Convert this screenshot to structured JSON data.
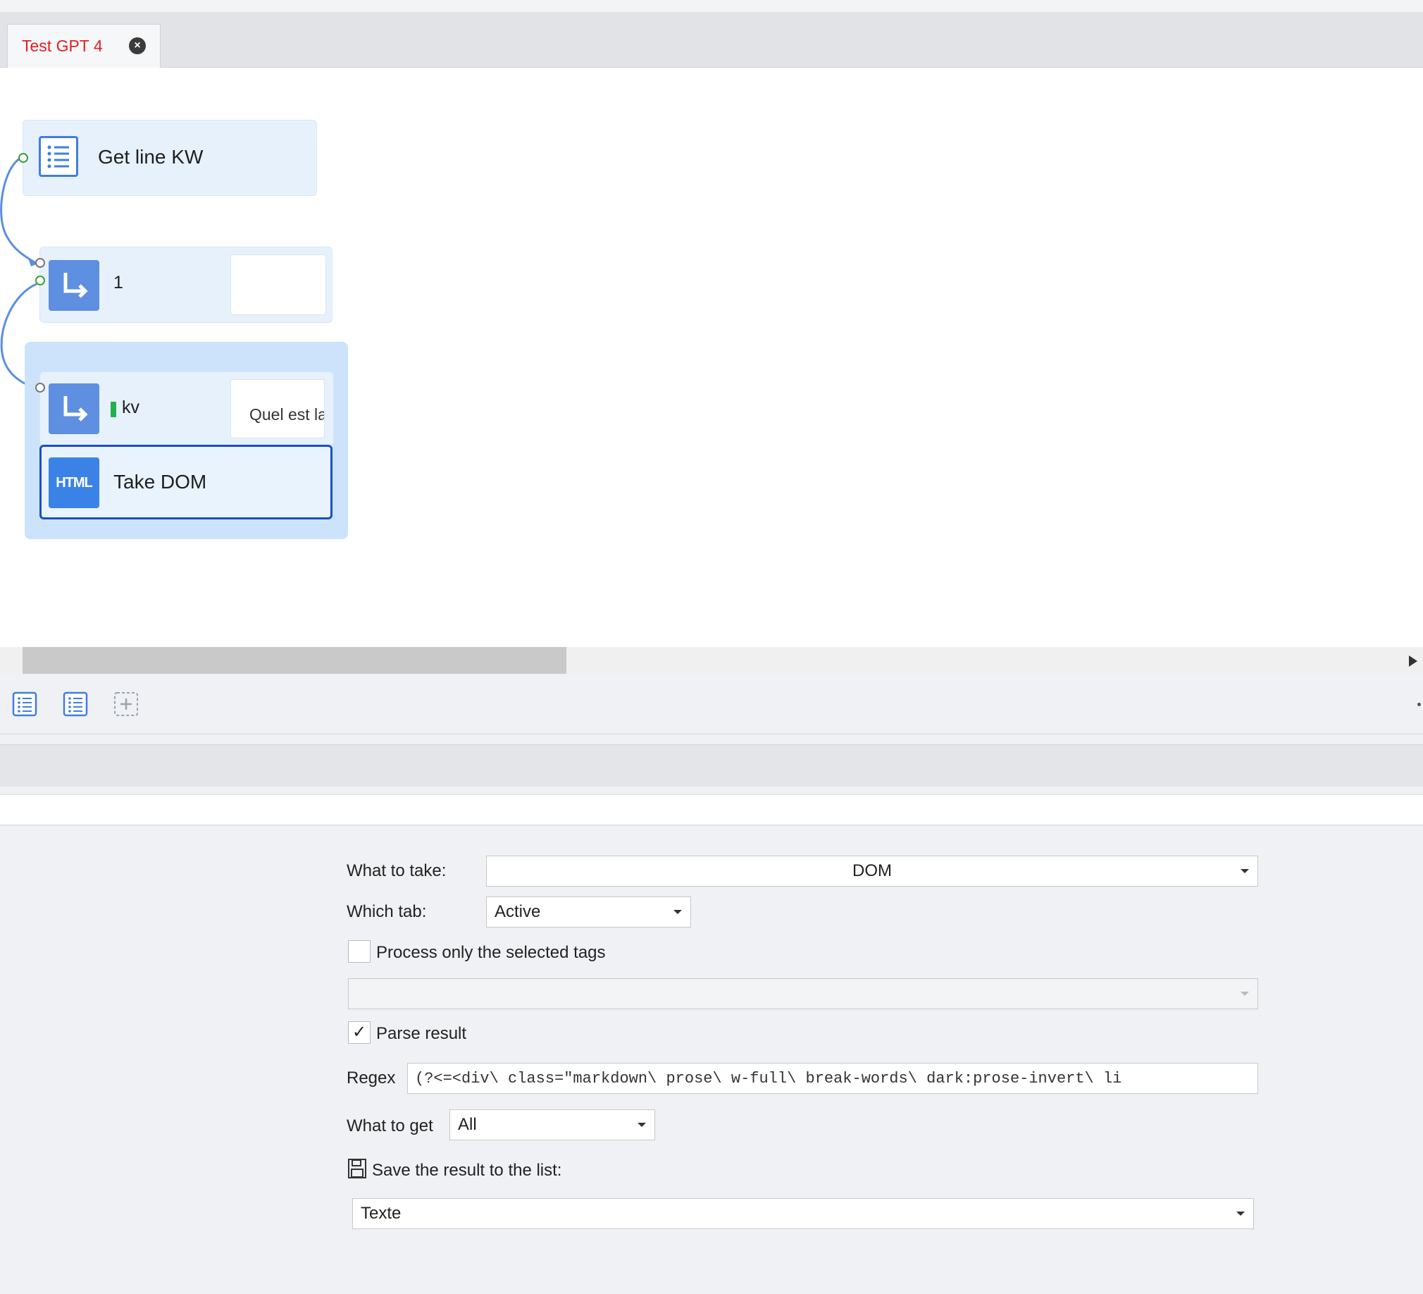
{
  "tabs": [
    {
      "label": "Test GPT 4",
      "close_icon": "close-icon"
    }
  ],
  "nodes": {
    "get_line": {
      "label": "Get line KW",
      "icon": "list-icon"
    },
    "goto_1": {
      "label": "1",
      "icon": "arrow-turn-icon",
      "preview": ""
    },
    "goto_kv": {
      "label": "kv",
      "icon": "arrow-turn-icon",
      "preview": "Quel est la"
    },
    "take_dom": {
      "label": "Take DOM",
      "icon_text": "HTML"
    }
  },
  "toolbar": {
    "buttons": [
      "list-view-icon",
      "list-view-icon",
      "add-block-icon"
    ]
  },
  "properties": {
    "what_to_take": {
      "label": "What to take:",
      "value": "DOM"
    },
    "which_tab": {
      "label": "Which tab:",
      "value": "Active"
    },
    "process_selected": {
      "label": "Process only the selected tags",
      "checked": false
    },
    "tags_select": {
      "value": ""
    },
    "parse_result": {
      "label": "Parse result",
      "checked": true,
      "check_glyph": "✓"
    },
    "regex": {
      "label": "Regex",
      "value": "(?<=<div\\ class=\"markdown\\ prose\\ w-full\\ break-words\\ dark:prose-invert\\ li"
    },
    "what_to_get": {
      "label": "What to get",
      "value": "All"
    },
    "save_result": {
      "label": "Save the result to the list:",
      "icon": "save-icon"
    },
    "list_select": {
      "value": "Texte"
    }
  },
  "colors": {
    "accent": "#1a73e8",
    "tab_text": "#e02020",
    "node_bg": "#e7f1fc",
    "group_bg": "#cce3fb",
    "icon_bg": "#5e8fe0",
    "selected_border": "#1a4fc4"
  }
}
